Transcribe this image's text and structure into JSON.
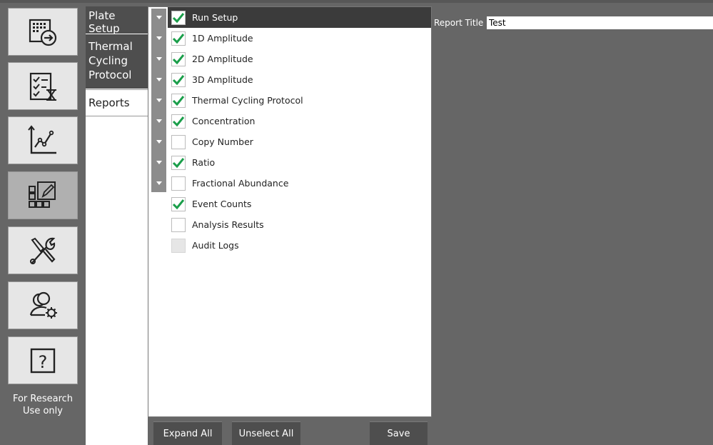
{
  "nav": {
    "items": [
      {
        "name": "plate-setup-nav",
        "icon": "export-plate-icon"
      },
      {
        "name": "run-nav",
        "icon": "checklist-timer-icon"
      },
      {
        "name": "analysis-nav",
        "icon": "line-chart-icon"
      },
      {
        "name": "reports-nav",
        "icon": "layout-edit-icon",
        "active": true
      },
      {
        "name": "tools-nav",
        "icon": "wrench-screwdriver-icon"
      },
      {
        "name": "users-nav",
        "icon": "user-settings-icon"
      },
      {
        "name": "help-nav",
        "icon": "help-icon"
      }
    ],
    "footer": "For Research Use only"
  },
  "subnav": {
    "tabs": [
      {
        "label": "Plate Setup"
      },
      {
        "label": "Thermal Cycling Protocol"
      },
      {
        "label": "Reports",
        "active": true
      }
    ]
  },
  "tree": {
    "items": [
      {
        "label": "Run Setup",
        "checked": true,
        "expandable": true,
        "selected": true
      },
      {
        "label": "1D Amplitude",
        "checked": true,
        "expandable": true
      },
      {
        "label": "2D Amplitude",
        "checked": true,
        "expandable": true
      },
      {
        "label": "3D Amplitude",
        "checked": true,
        "expandable": true
      },
      {
        "label": "Thermal Cycling Protocol",
        "checked": true,
        "expandable": true
      },
      {
        "label": "Concentration",
        "checked": true,
        "expandable": true
      },
      {
        "label": "Copy Number",
        "checked": false,
        "expandable": true
      },
      {
        "label": "Ratio",
        "checked": true,
        "expandable": true
      },
      {
        "label": "Fractional Abundance",
        "checked": false,
        "expandable": true
      },
      {
        "label": "Event Counts",
        "checked": true,
        "expandable": false
      },
      {
        "label": "Analysis Results",
        "checked": false,
        "expandable": false
      },
      {
        "label": "Audit Logs",
        "checked": false,
        "expandable": false,
        "disabled": true
      }
    ]
  },
  "buttons": {
    "expand_all": "Expand All",
    "unselect_all": "Unselect All",
    "save": "Save"
  },
  "report_title": {
    "label": "Report Title",
    "value": "Test"
  },
  "colors": {
    "check": "#1a9e4a",
    "panel_bg": "#666666",
    "selected_row": "#3b3b3b",
    "tab_bg": "#4e4e4e"
  }
}
